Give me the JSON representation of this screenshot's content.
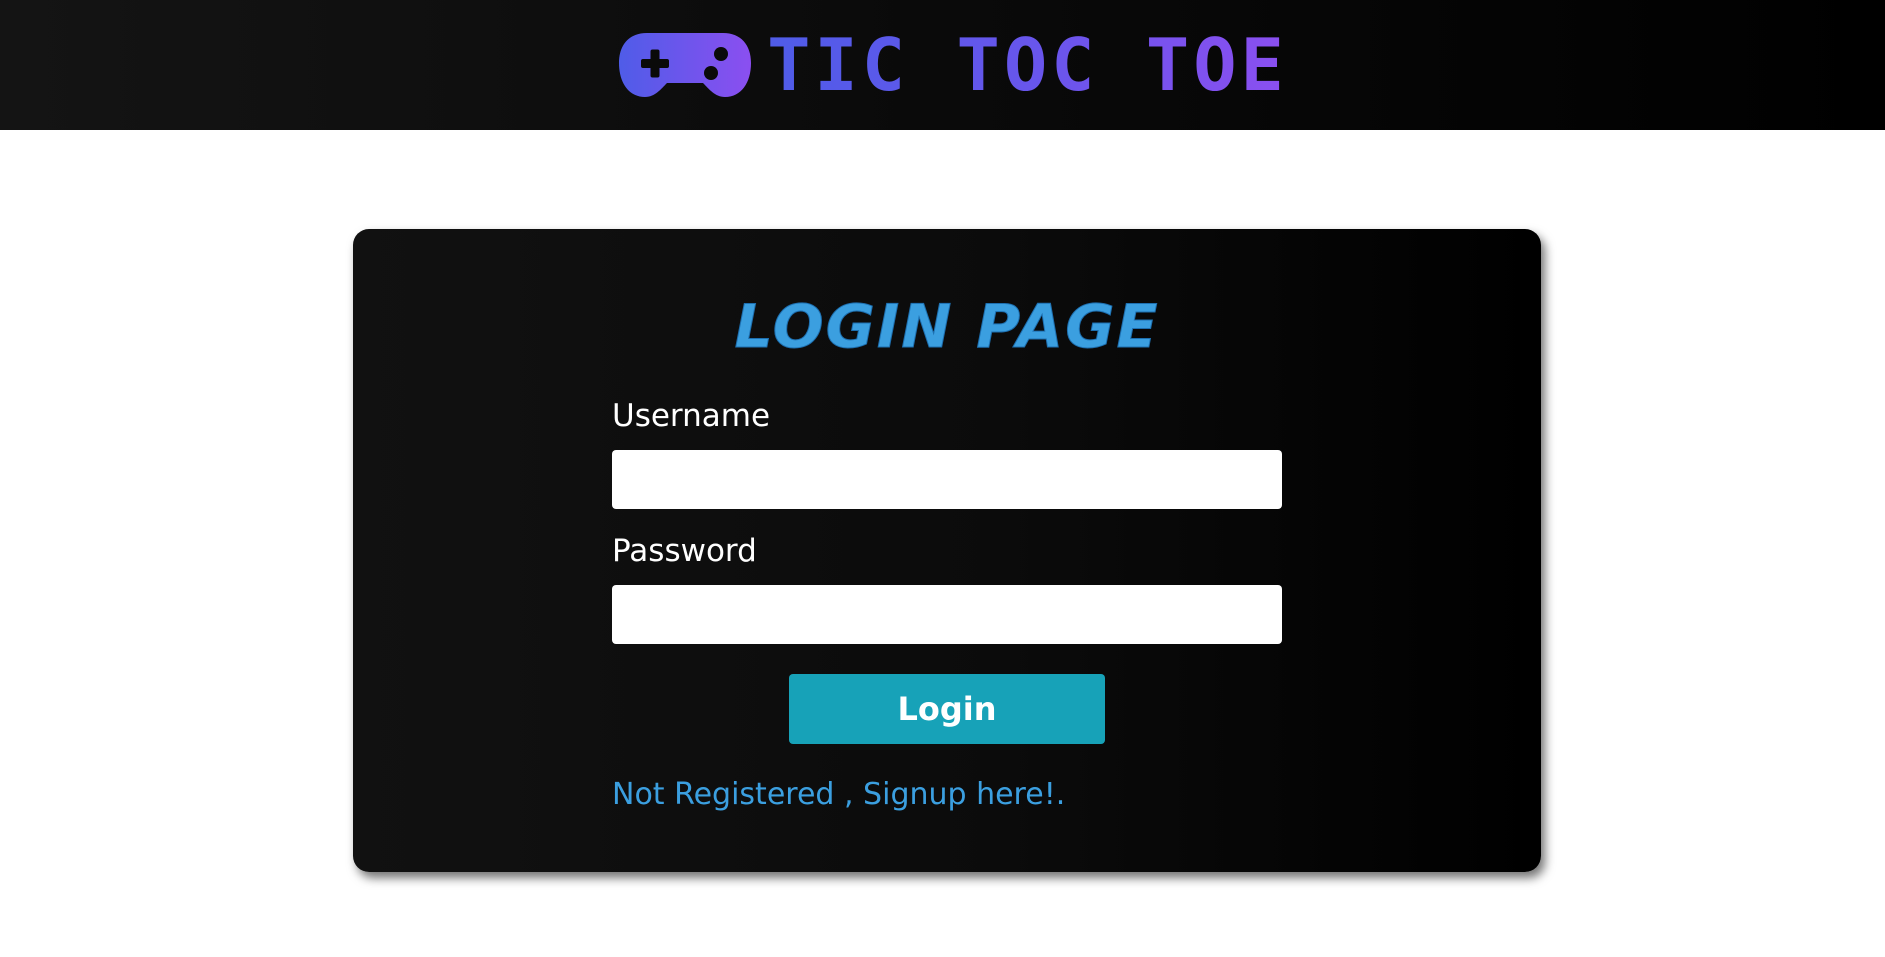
{
  "header": {
    "title": "TIC TOC TOE",
    "logo_icon": "gamepad-icon",
    "gradient_start": "#4f5ce8",
    "gradient_end": "#8b4ff0"
  },
  "login": {
    "title": "LOGIN PAGE",
    "username_label": "Username",
    "username_value": "",
    "password_label": "Password",
    "password_value": "",
    "submit_label": "Login",
    "signup_link": "Not Registered , Signup here!.",
    "accent_color": "#3b9fe0",
    "button_color": "#17a2b8"
  }
}
